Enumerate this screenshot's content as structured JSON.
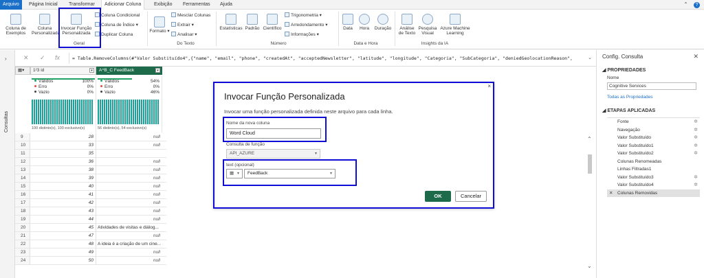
{
  "tabs": [
    "Arquivo",
    "Página Inicial",
    "Transformar",
    "Adicionar Coluna",
    "Exibição",
    "Ferramentas",
    "Ajuda"
  ],
  "ribbon": {
    "col_exemplos": "Coluna de Exemplos",
    "col_personalizada": "Coluna Personalizada",
    "invocar_funcao": "Invocar Função Personalizada",
    "col_condicional": "Coluna Condicional",
    "col_indice": "Coluna de Índice",
    "duplicar_coluna": "Duplicar Coluna",
    "group_geral": "Geral",
    "formato": "Formato",
    "mesclar_colunas": "Mesclar Colunas",
    "extrair": "Extrair",
    "analisar": "Analisar",
    "group_texto": "Do Texto",
    "estatisticas": "Estatísticas",
    "padrao": "Padrão",
    "cientifico": "Científico",
    "trigonometria": "Trigonometria",
    "arredondamento": "Arredondamento",
    "informacoes": "Informações",
    "group_numero": "Número",
    "data": "Data",
    "hora": "Hora",
    "duracao": "Duração",
    "group_data_hora": "Data e Hora",
    "analise_texto": "Análise de Texto",
    "pesquisa_visual": "Pesquisa Visual",
    "azure_ml": "Azure Machine Learning",
    "group_ia": "Insights da IA"
  },
  "leftrail": {
    "label": "Consultas"
  },
  "formula": "= Table.RemoveColumns(#\"Valor Substituído4\",{\"name\", \"email\", \"phone\", \"createdAt\", \"acceptedNewsletter\", \"latitude\", \"longitude\", \"Categoria\", \"SubCategoria\", \"deniedGeolocationReason\",",
  "grid": {
    "col1": "id",
    "col2": "FeedBack",
    "col1_type": "1²3",
    "col2_type": "A^B_C",
    "quality1": [
      {
        "label": "Válidos",
        "pct": "100%"
      },
      {
        "label": "Erro",
        "pct": "0%"
      },
      {
        "label": "Vazio",
        "pct": "0%"
      }
    ],
    "quality2": [
      {
        "label": "Válidos",
        "pct": "54%"
      },
      {
        "label": "Erro",
        "pct": "0%"
      },
      {
        "label": "Vazio",
        "pct": "46%"
      }
    ],
    "distinct1": "100 distinto(s), 100 exclusivo(s)",
    "distinct2": "56 distinto(s), 54 exclusivo(s)",
    "rows": [
      {
        "n": "9",
        "id": "28",
        "fb": "null"
      },
      {
        "n": "10",
        "id": "33",
        "fb": "null"
      },
      {
        "n": "11",
        "id": "35",
        "fb": ""
      },
      {
        "n": "12",
        "id": "36",
        "fb": "null"
      },
      {
        "n": "13",
        "id": "38",
        "fb": "null"
      },
      {
        "n": "14",
        "id": "39",
        "fb": "null"
      },
      {
        "n": "15",
        "id": "40",
        "fb": "null"
      },
      {
        "n": "16",
        "id": "41",
        "fb": "null"
      },
      {
        "n": "17",
        "id": "42",
        "fb": "null"
      },
      {
        "n": "18",
        "id": "43",
        "fb": "null"
      },
      {
        "n": "19",
        "id": "44",
        "fb": "null"
      },
      {
        "n": "20",
        "id": "45",
        "fb": "Atividades de visitas e diálog..."
      },
      {
        "n": "21",
        "id": "47",
        "fb": "null"
      },
      {
        "n": "22",
        "id": "48",
        "fb": "A ideia é a criação de um cine..."
      },
      {
        "n": "23",
        "id": "49",
        "fb": "null"
      },
      {
        "n": "24",
        "id": "50",
        "fb": "null"
      }
    ]
  },
  "dialog": {
    "title": "Invocar Função Personalizada",
    "description": "Invocar uma função personalizada definida neste arquivo para cada linha.",
    "new_col_label": "Nome da nova coluna",
    "new_col_value": "Word Cloud",
    "func_query_label": "Consulta de função",
    "func_query_value": "API_AZURE",
    "text_label": "text (opcional)",
    "text_value": "FeedBack",
    "ok": "OK",
    "cancel": "Cancelar"
  },
  "rightpane": {
    "title": "Config. Consulta",
    "props_title": "PROPRIEDADES",
    "name_label": "Nome",
    "name_value": "Cognitive Services",
    "all_props": "Todas as Propriedades",
    "steps_title": "ETAPAS APLICADAS",
    "steps": [
      {
        "label": "Fonte",
        "gear": true
      },
      {
        "label": "Navegação",
        "gear": true
      },
      {
        "label": "Valor Substituído",
        "gear": true
      },
      {
        "label": "Valor Substituído1",
        "gear": true
      },
      {
        "label": "Valor Substituído2",
        "gear": true
      },
      {
        "label": "Colunas Renomeadas",
        "gear": false
      },
      {
        "label": "Linhas Filtradas1",
        "gear": false
      },
      {
        "label": "Valor Substituído3",
        "gear": true
      },
      {
        "label": "Valor Substituído4",
        "gear": true
      },
      {
        "label": "Colunas Removidas",
        "gear": false,
        "selected": true
      }
    ]
  }
}
